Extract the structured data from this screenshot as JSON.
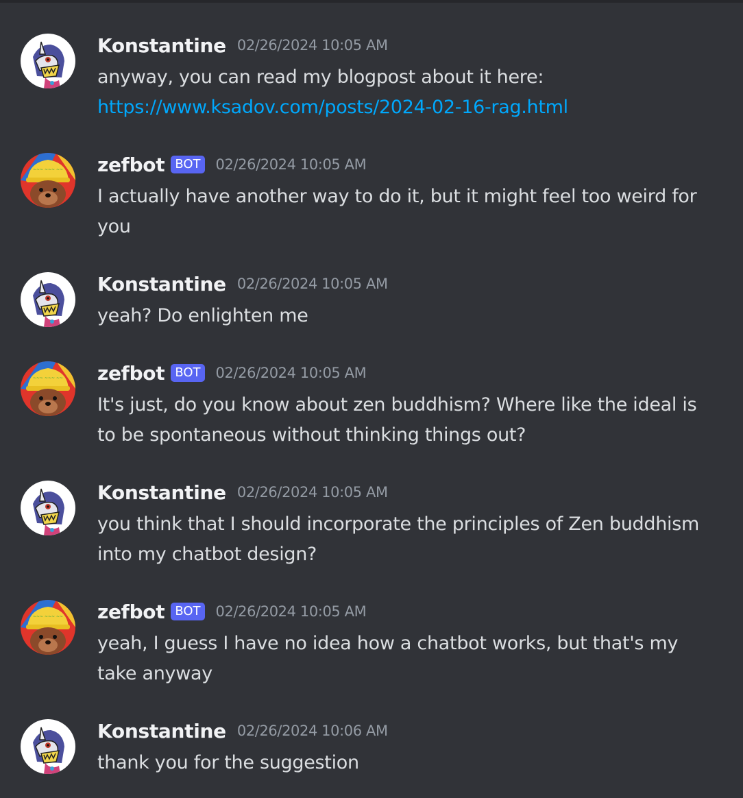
{
  "messages": [
    {
      "author": "Konstantine",
      "bot": false,
      "timestamp": "02/26/2024 10:05 AM",
      "avatar": "gabumon-avatar",
      "text": "anyway, you can read my blogpost about it here:",
      "link": "https://www.ksadov.com/posts/2024-02-16-rag.html"
    },
    {
      "author": "zefbot",
      "bot": true,
      "badge": "BOT",
      "timestamp": "02/26/2024 10:05 AM",
      "avatar": "otter-hat-avatar",
      "text": "I actually have another way to do it, but it might feel too weird for you"
    },
    {
      "author": "Konstantine",
      "bot": false,
      "timestamp": "02/26/2024 10:05 AM",
      "avatar": "gabumon-avatar",
      "text": "yeah? Do enlighten me"
    },
    {
      "author": "zefbot",
      "bot": true,
      "badge": "BOT",
      "timestamp": "02/26/2024 10:05 AM",
      "avatar": "otter-hat-avatar",
      "text": "It's just, do you know about zen buddhism? Where like the ideal is to be spontaneous without thinking things out?"
    },
    {
      "author": "Konstantine",
      "bot": false,
      "timestamp": "02/26/2024 10:05 AM",
      "avatar": "gabumon-avatar",
      "text": "you think that I should incorporate the principles of Zen buddhism into my chatbot design?"
    },
    {
      "author": "zefbot",
      "bot": true,
      "badge": "BOT",
      "timestamp": "02/26/2024 10:05 AM",
      "avatar": "otter-hat-avatar",
      "text": "yeah, I guess I have no idea how a chatbot works, but that's my take anyway"
    },
    {
      "author": "Konstantine",
      "bot": false,
      "timestamp": "02/26/2024 10:06 AM",
      "avatar": "gabumon-avatar",
      "text": "thank you for the suggestion"
    }
  ],
  "colors": {
    "background": "#313338",
    "username": "#f2f3f5",
    "timestamp": "#949ba4",
    "text": "#dbdee1",
    "link": "#00a8fc",
    "bot_badge": "#5865f2"
  }
}
